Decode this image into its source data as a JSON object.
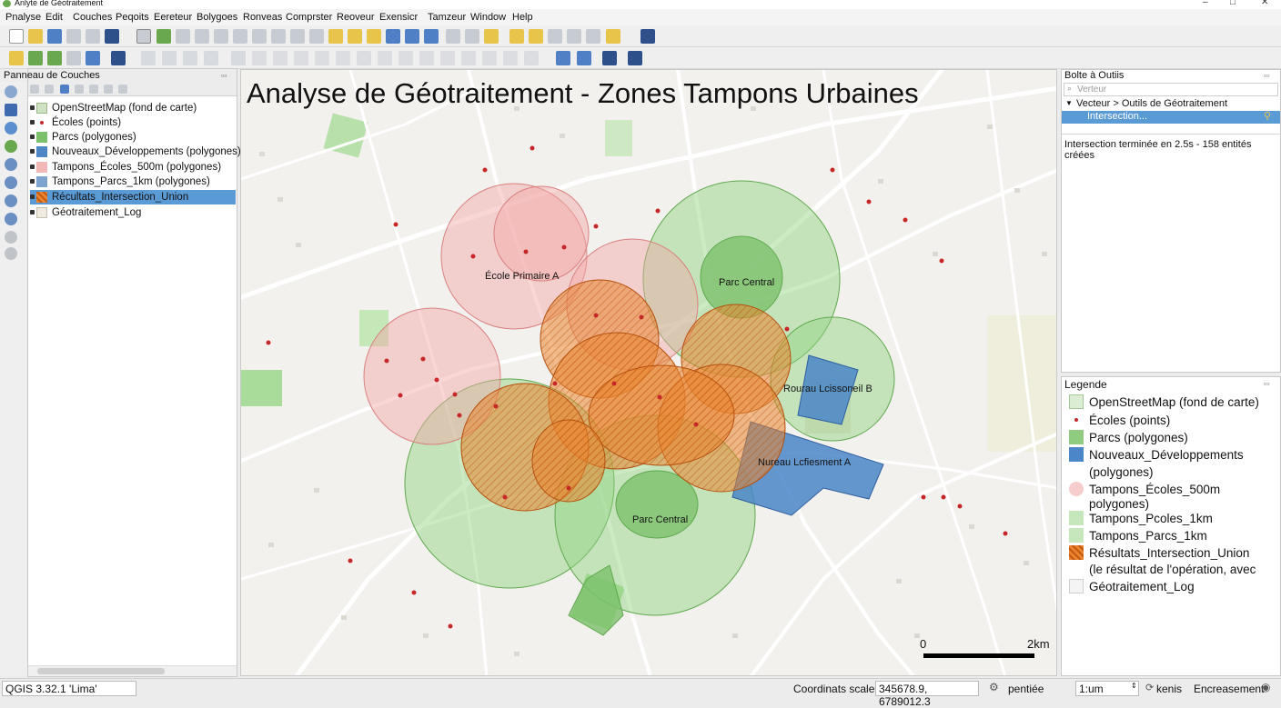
{
  "window": {
    "title": "Anlyte de Géotraitement"
  },
  "menu": [
    "Pnalyse",
    "Edit",
    "Couches",
    "Peqoits",
    "Eereteur",
    "Bolygoes",
    "Ronveas",
    "Comprster",
    "Reoveur",
    "Exensicr",
    "Tamzeur",
    "Window",
    "Help"
  ],
  "layers_panel": {
    "title": "Panneau de Couches",
    "layers": [
      {
        "label": "OpenStreetMap (fond de carte)",
        "swatch": "#cfe3c4",
        "kind": "osm"
      },
      {
        "label": "Écoles (points)",
        "swatch": "#c62828",
        "kind": "point"
      },
      {
        "label": "Parcs (polygones)",
        "swatch": "#7cc06b",
        "kind": "fill"
      },
      {
        "label": "Nouveaux_Développements (polygones)",
        "swatch": "#4f86c6",
        "kind": "fill"
      },
      {
        "label": "Tampons_Écoles_500m (polygones)",
        "swatch": "#f2b8b8",
        "kind": "fill"
      },
      {
        "label": "Tampons_Parcs_1km (polygones)",
        "swatch": "#7ea3cf",
        "kind": "fill"
      },
      {
        "label": "Récultats_Intersection_Union",
        "swatch": "#e9842f",
        "kind": "hatch",
        "selected": true
      },
      {
        "label": "Géotraitement_Log",
        "swatch": "#e8e2d6",
        "kind": "log"
      }
    ]
  },
  "map": {
    "title": "Analyse de Géotraitement - Zones Tampons Urbaines",
    "labels": {
      "ecole_a": "École Primaire A",
      "parc_central_1": "Parc Central",
      "parc_central_2": "Parc Central",
      "bureau_b": "Rourau Lcissoneil B",
      "nouveau_a": "Nureau Lcfiesment A"
    },
    "scalebar": {
      "start": "0",
      "end": "2km"
    },
    "colors": {
      "school_buffer": "#f2a7a7",
      "park_buffer": "#8ed27f",
      "intersection": "#e9842f",
      "development": "#4a86c8",
      "park": "#7cc06b",
      "school_point": "#c62828"
    }
  },
  "toolbox": {
    "title": "Bolte à Outiis",
    "search_placeholder": "Verteur",
    "tree_root": "Vecteur > Outils de Géotraitement",
    "selected_tool": "Intersection...",
    "log": "Intersection terminée en 2.5s - 158 entités créées"
  },
  "legend": {
    "title": "Legende",
    "items": [
      {
        "label": "OpenStreetMap (fond de carte)",
        "kind": "osm"
      },
      {
        "label": "Écoles (points)",
        "kind": "point"
      },
      {
        "label": "Parcs (polygones)",
        "kind": "park"
      },
      {
        "label": "Nouveaux_Développements",
        "label2": "(polygones)",
        "kind": "dev"
      },
      {
        "label": "Tampons_Écoles_500m",
        "label2": "polygones)",
        "kind": "school_buffer"
      },
      {
        "label": "Tampons_Pcoles_1km",
        "kind": "park_buffer"
      },
      {
        "label": "Tampons_Parcs_1km",
        "kind": "park_buffer"
      },
      {
        "label": "Résultats_Intersection_Union",
        "label2": "(le résultat de l'opération, avec",
        "kind": "hatch"
      },
      {
        "label": "Géotraitement_Log",
        "kind": "log"
      }
    ]
  },
  "status": {
    "version": "QGIS 3.32.1 'Lima'",
    "coords_label": "Coordinats scale",
    "coords_value": "345678.9, 6789012.3",
    "magnifier": "pentiée",
    "scale_value": "1:um",
    "rotation": "kenis",
    "render": "Encreasement"
  }
}
